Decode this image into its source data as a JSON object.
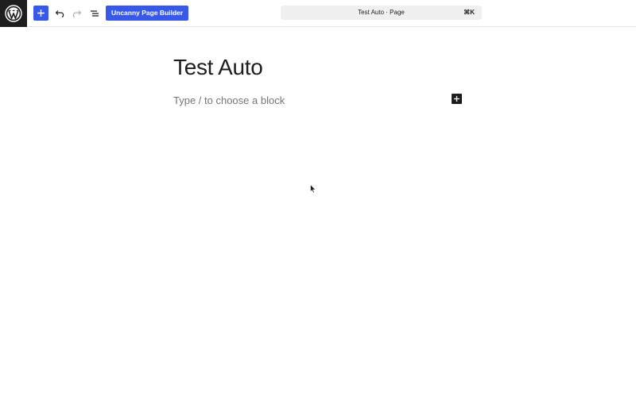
{
  "topbar": {
    "wp_logo_icon": "wordpress-logo-icon",
    "inserter_icon": "plus-icon",
    "undo_icon": "undo-icon",
    "redo_icon": "redo-icon",
    "document_overview_icon": "list-view-icon",
    "page_builder_label": "Uncanny Page Builder",
    "accent_color": "#3858e9"
  },
  "command_bar": {
    "title": "Test Auto · Page",
    "shortcut": "⌘K"
  },
  "editor": {
    "post_title": "Test Auto",
    "block_placeholder": "Type / to choose a block",
    "inline_inserter_icon": "plus-icon"
  }
}
